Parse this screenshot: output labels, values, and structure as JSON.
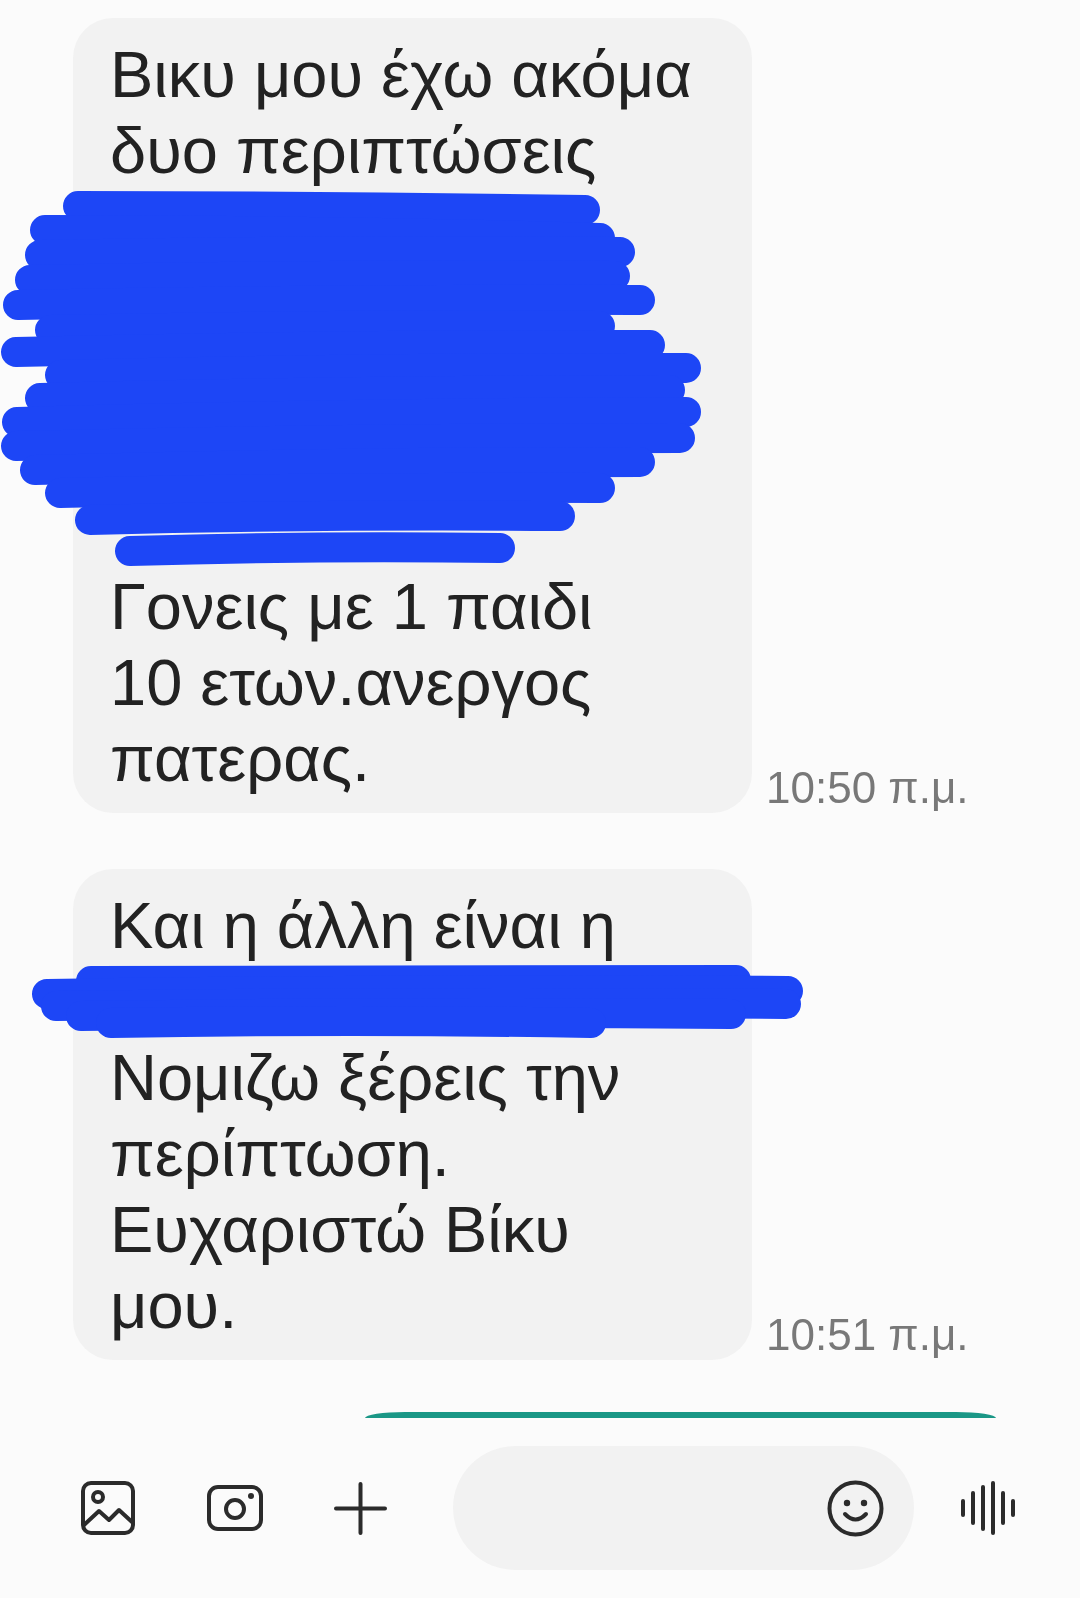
{
  "messages": [
    {
      "texts": [
        "Βικυ μου έχω ακόμα\nδυο περιπτώσεις",
        "Γονεις με 1 παιδι\n10 ετων.ανεργος\nπατερας."
      ],
      "time": "10:50 π.μ."
    },
    {
      "texts": [
        "Και η άλλη είναι η",
        "Νομιζω ξέρεις την\nπερίπτωση.\nΕυχαριστώ Βίκυ\nμου."
      ],
      "time": "10:51 π.μ."
    }
  ]
}
